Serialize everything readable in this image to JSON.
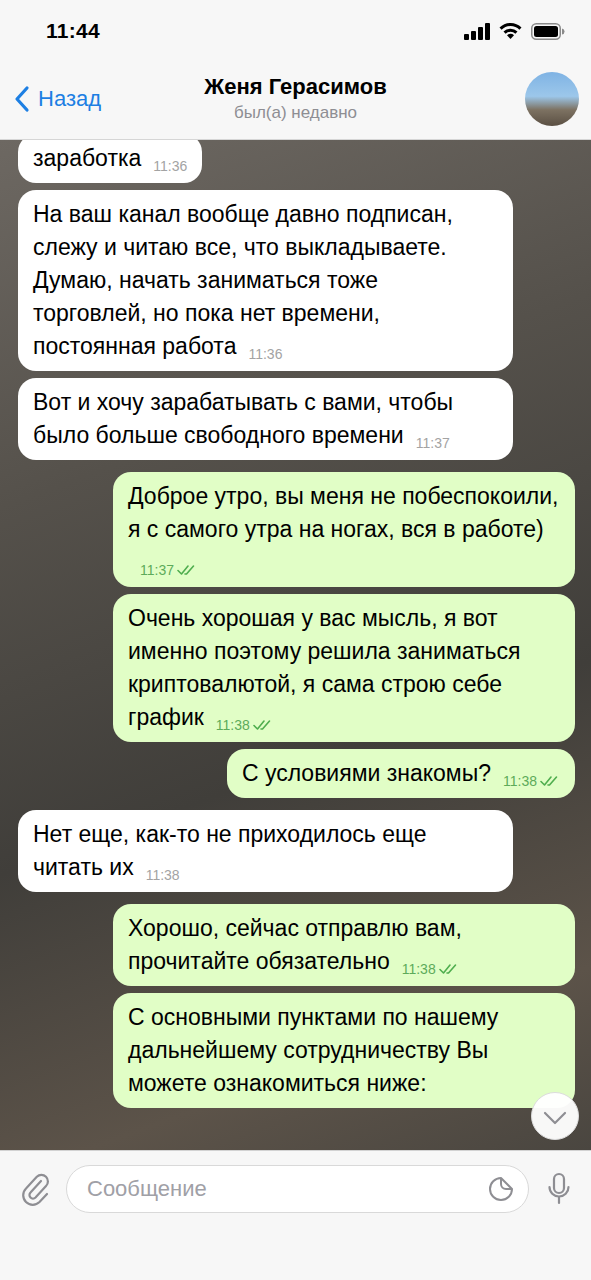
{
  "status_bar": {
    "time": "11:44"
  },
  "header": {
    "back": "Назад",
    "title": "Женя Герасимов",
    "subtitle": "был(а) недавно"
  },
  "messages": [
    {
      "kind": "incoming",
      "text": "заработка",
      "time": "11:36"
    },
    {
      "kind": "incoming",
      "text": "На ваш канал вообще давно подписан, слежу и читаю все, что выкладываете. Думаю, начать заниматься тоже торговлей, но пока нет времени, постоянная работа",
      "time": "11:36"
    },
    {
      "kind": "incoming",
      "text": "Вот и хочу зарабатывать с вами, чтобы было больше свободного времени",
      "time": "11:37"
    },
    {
      "kind": "outgoing",
      "text": "Доброе утро, вы меня не побеспокоили, я с самого утра на ногах, вся в работе)",
      "time": "11:37",
      "read": true
    },
    {
      "kind": "outgoing",
      "text": "Очень хорошая у вас мысль, я вот именно поэтому решила заниматься криптовалютой, я сама строю себе график",
      "time": "11:38",
      "read": true
    },
    {
      "kind": "outgoing",
      "text": "С условиями знакомы?",
      "time": "11:38",
      "read": true
    },
    {
      "kind": "incoming",
      "text": "Нет еще, как-то не приходилось еще читать их",
      "time": "11:38"
    },
    {
      "kind": "outgoing",
      "text": "Хорошо, сейчас отправлю вам, прочитайте обязательно",
      "time": "11:38",
      "read": true
    },
    {
      "kind": "outgoing",
      "text": "С основными пунктами по нашему дальнейшему сотрудничеству Вы можете ознакомиться ниже:"
    }
  ],
  "composer": {
    "placeholder": "Сообщение"
  }
}
